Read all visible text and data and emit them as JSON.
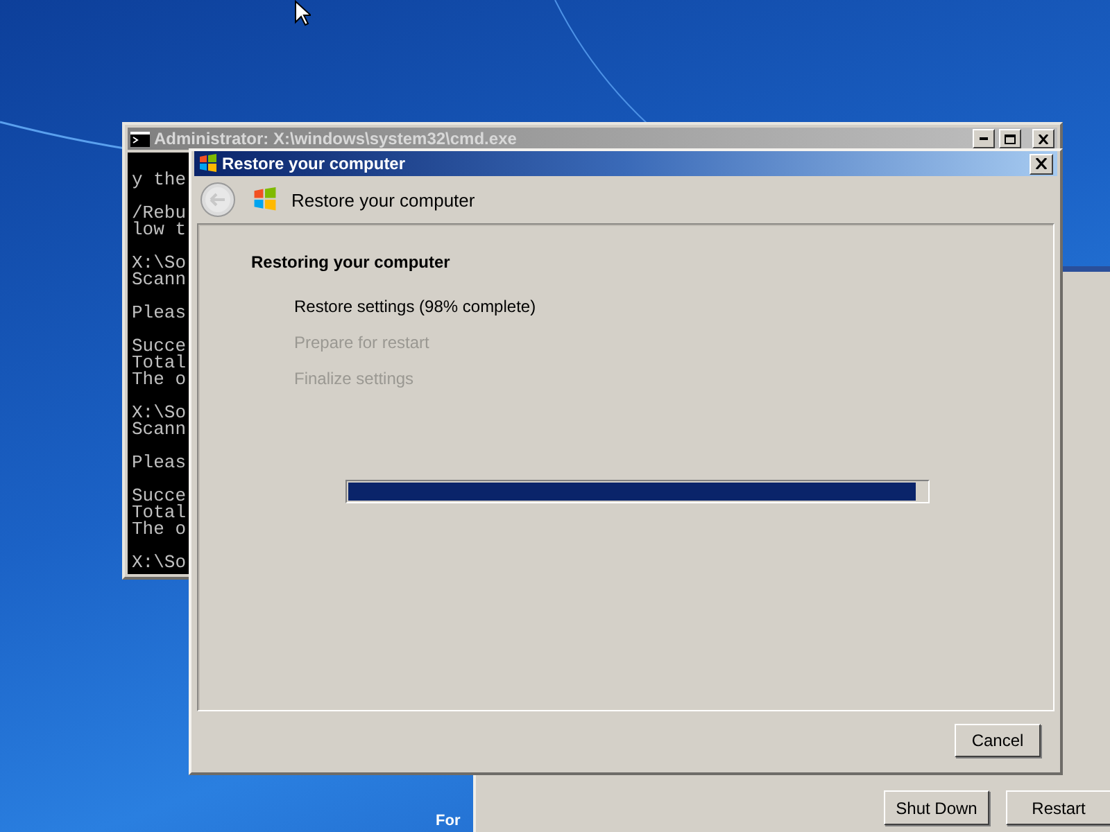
{
  "desktop": {
    "caption": "For"
  },
  "console_window": {
    "title": "Administrator: X:\\windows\\system32\\cmd.exe",
    "blocks": [
      [
        "y the"
      ],
      [
        "/Rebu",
        "low t"
      ],
      [
        "X:\\So",
        "Scann"
      ],
      [
        "Pleas"
      ],
      [
        "Succe",
        "Total",
        "The o"
      ],
      [
        "X:\\So",
        "Scann"
      ],
      [
        "Pleas"
      ],
      [
        "Succe",
        "Total",
        "The o"
      ],
      [
        "X:\\So"
      ]
    ]
  },
  "recovery_window": {
    "buttons": [
      "Shut Down",
      "Restart"
    ]
  },
  "restore_dialog": {
    "title": "Restore your computer",
    "header": "Restore your computer",
    "heading": "Restoring your computer",
    "steps": [
      {
        "label": "Restore settings (98% complete)",
        "active": true
      },
      {
        "label": "Prepare for restart",
        "active": false
      },
      {
        "label": "Finalize settings",
        "active": false
      }
    ],
    "progress": {
      "level": 0.98
    },
    "buttons": [
      "Cancel"
    ]
  }
}
